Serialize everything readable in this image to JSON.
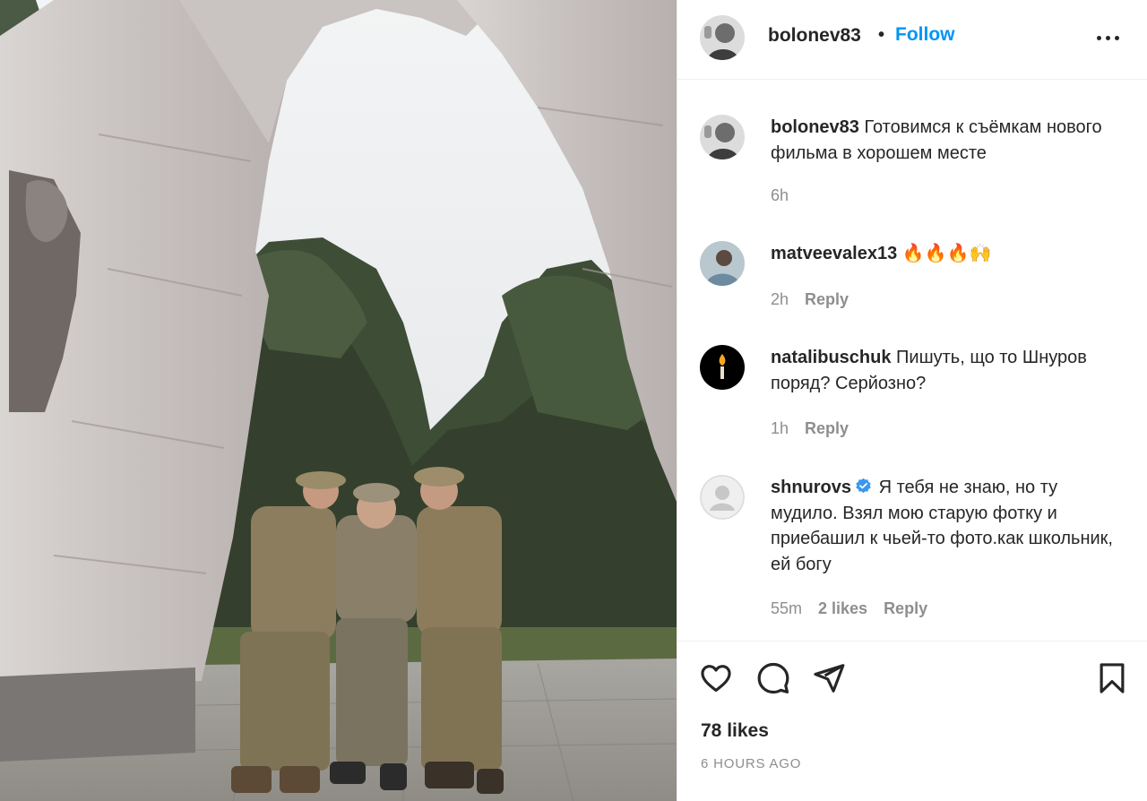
{
  "post": {
    "username": "bolonev83",
    "separator": "•",
    "follow_label": "Follow",
    "more_icon": "more-horizontal-icon",
    "caption": {
      "author": "bolonev83",
      "text": "Готовимся к съёмкам нового фильма в хорошем месте",
      "time": "6h"
    },
    "comments": [
      {
        "author": "matveevalex13",
        "text": "🔥🔥🔥🙌",
        "time": "2h",
        "reply_label": "Reply",
        "verified": false
      },
      {
        "author": "natalibuschuk",
        "text": "Пишуть, що то Шнуров поряд? Серйозно?",
        "time": "1h",
        "reply_label": "Reply",
        "verified": false
      },
      {
        "author": "shnurovs",
        "text": "Я тебя не знаю, но ту мудило. Взял мою старую фотку и приебашил к чьей-то фото.как школьник, ей богу",
        "time": "55m",
        "likes_label": "2 likes",
        "reply_label": "Reply",
        "verified": true
      }
    ],
    "actions": {
      "icons": [
        "heart-icon",
        "comment-icon",
        "share-icon",
        "bookmark-icon"
      ]
    },
    "likes": "78 likes",
    "timestamp": "6 HOURS AGO",
    "colors": {
      "link_blue": "#0095f6",
      "text": "#262626",
      "muted": "#8e8e8e",
      "border": "#efefef",
      "verified_badge": "#3897f0"
    }
  }
}
